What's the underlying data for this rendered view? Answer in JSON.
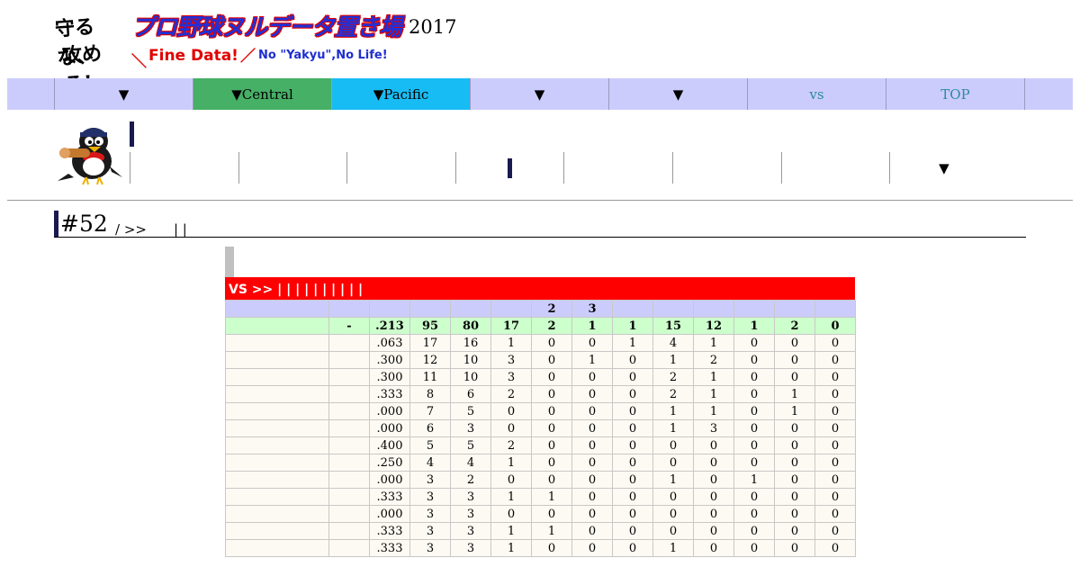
{
  "header": {
    "logo_line1": "守るな、",
    "logo_line2": "攻めろ!",
    "site_title": "プロ野球ヌルデータ置き場",
    "year": "2017",
    "sub_slash1": "＼",
    "sub_fine": "Fine Data!",
    "sub_slash2": "／",
    "sub_yakyu": "No \"Yakyu\",No Life!"
  },
  "nav": {
    "items": [
      {
        "label": "▼"
      },
      {
        "label": "▼Central"
      },
      {
        "label": "▼Pacific"
      },
      {
        "label": "▼"
      },
      {
        "label": "▼"
      },
      {
        "label": "vs"
      },
      {
        "label": "TOP"
      }
    ]
  },
  "subnav": {
    "last_label": "▼"
  },
  "player": {
    "number": "#52",
    "crumb": "/ >>　　| |"
  },
  "stats": {
    "title": "VS >> | | | | | | | | | |",
    "header": [
      "",
      "",
      "",
      "",
      "",
      "",
      "2",
      "3",
      "",
      "",
      "",
      "",
      "",
      "",
      ""
    ],
    "total": [
      "",
      "-",
      ".213",
      "95",
      "80",
      "17",
      "2",
      "1",
      "1",
      "15",
      "12",
      "1",
      "2",
      "0"
    ],
    "rows": [
      [
        ".063",
        "17",
        "16",
        "1",
        "0",
        "0",
        "1",
        "4",
        "1",
        "0",
        "0",
        "0"
      ],
      [
        ".300",
        "12",
        "10",
        "3",
        "0",
        "1",
        "0",
        "1",
        "2",
        "0",
        "0",
        "0"
      ],
      [
        ".300",
        "11",
        "10",
        "3",
        "0",
        "0",
        "0",
        "2",
        "1",
        "0",
        "0",
        "0"
      ],
      [
        ".333",
        "8",
        "6",
        "2",
        "0",
        "0",
        "0",
        "2",
        "1",
        "0",
        "1",
        "0"
      ],
      [
        ".000",
        "7",
        "5",
        "0",
        "0",
        "0",
        "0",
        "1",
        "1",
        "0",
        "1",
        "0"
      ],
      [
        ".000",
        "6",
        "3",
        "0",
        "0",
        "0",
        "0",
        "1",
        "3",
        "0",
        "0",
        "0"
      ],
      [
        ".400",
        "5",
        "5",
        "2",
        "0",
        "0",
        "0",
        "0",
        "0",
        "0",
        "0",
        "0"
      ],
      [
        ".250",
        "4",
        "4",
        "1",
        "0",
        "0",
        "0",
        "0",
        "0",
        "0",
        "0",
        "0"
      ],
      [
        ".000",
        "3",
        "2",
        "0",
        "0",
        "0",
        "0",
        "1",
        "0",
        "1",
        "0",
        "0"
      ],
      [
        ".333",
        "3",
        "3",
        "1",
        "1",
        "0",
        "0",
        "0",
        "0",
        "0",
        "0",
        "0"
      ],
      [
        ".000",
        "3",
        "3",
        "0",
        "0",
        "0",
        "0",
        "0",
        "0",
        "0",
        "0",
        "0"
      ],
      [
        ".333",
        "3",
        "3",
        "1",
        "1",
        "0",
        "0",
        "0",
        "0",
        "0",
        "0",
        "0"
      ],
      [
        ".333",
        "3",
        "3",
        "1",
        "0",
        "0",
        "0",
        "1",
        "0",
        "0",
        "0",
        "0"
      ]
    ]
  },
  "colors": {
    "nav_bg": "#ccccfc",
    "central": "#46b066",
    "pacific": "#18bcf4",
    "stats_title_bg": "#ff0000",
    "total_row_bg": "#ccffcc",
    "team_accent": "#1a1a50"
  },
  "icons": {
    "mascot": "swallow-mascot-icon",
    "logo": "handwritten-logo-icon"
  }
}
